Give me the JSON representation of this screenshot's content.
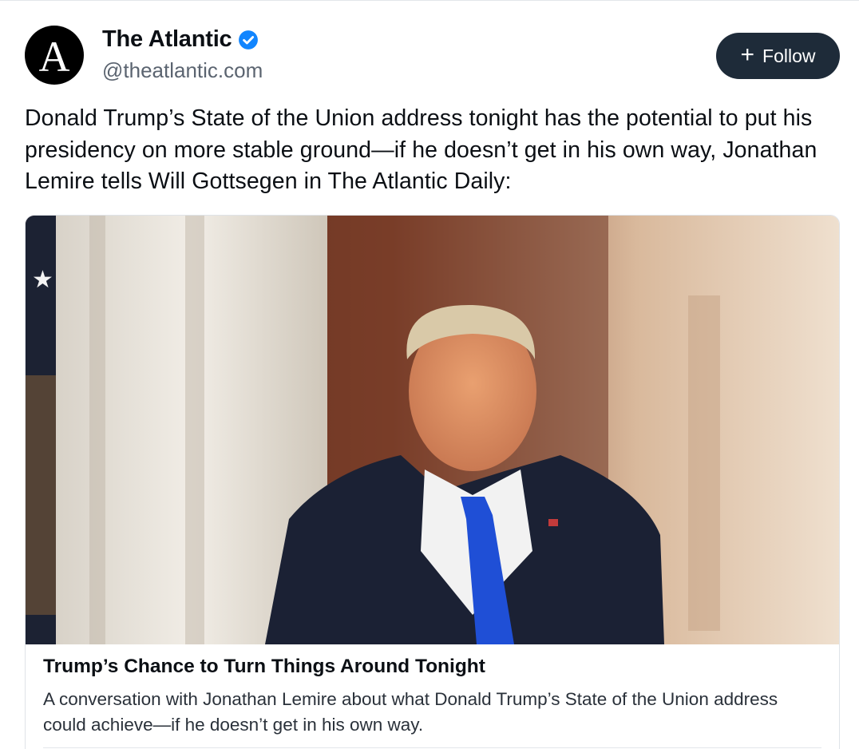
{
  "author": {
    "avatar_letter": "A",
    "display_name": "The Atlantic",
    "handle": "@theatlantic.com",
    "verified_icon": "verified-badge-icon",
    "verified_color": "#1185fe"
  },
  "follow_button": {
    "icon": "plus-icon",
    "label": "Follow"
  },
  "post": {
    "text": "Donald Trump’s State of the Union address tonight has the potential to put his presidency on more stable ground—if he doesn’t get in his own way, Jonathan Lemire tells Will Gottsegen in The Atlantic Daily:"
  },
  "link_card": {
    "thumbnail_alt": "Donald Trump in a dark suit and blue tie standing indoors",
    "title": "Trump’s Chance to Turn Things Around Tonight",
    "description": "A conversation with Jonathan Lemire about what Donald Trump’s State of the Union address could achieve—if he doesn’t get in his own way."
  },
  "colors": {
    "follow_bg": "#1e2b39",
    "handle_text": "#5b6470",
    "tie_blue": "#1f4fd6"
  }
}
